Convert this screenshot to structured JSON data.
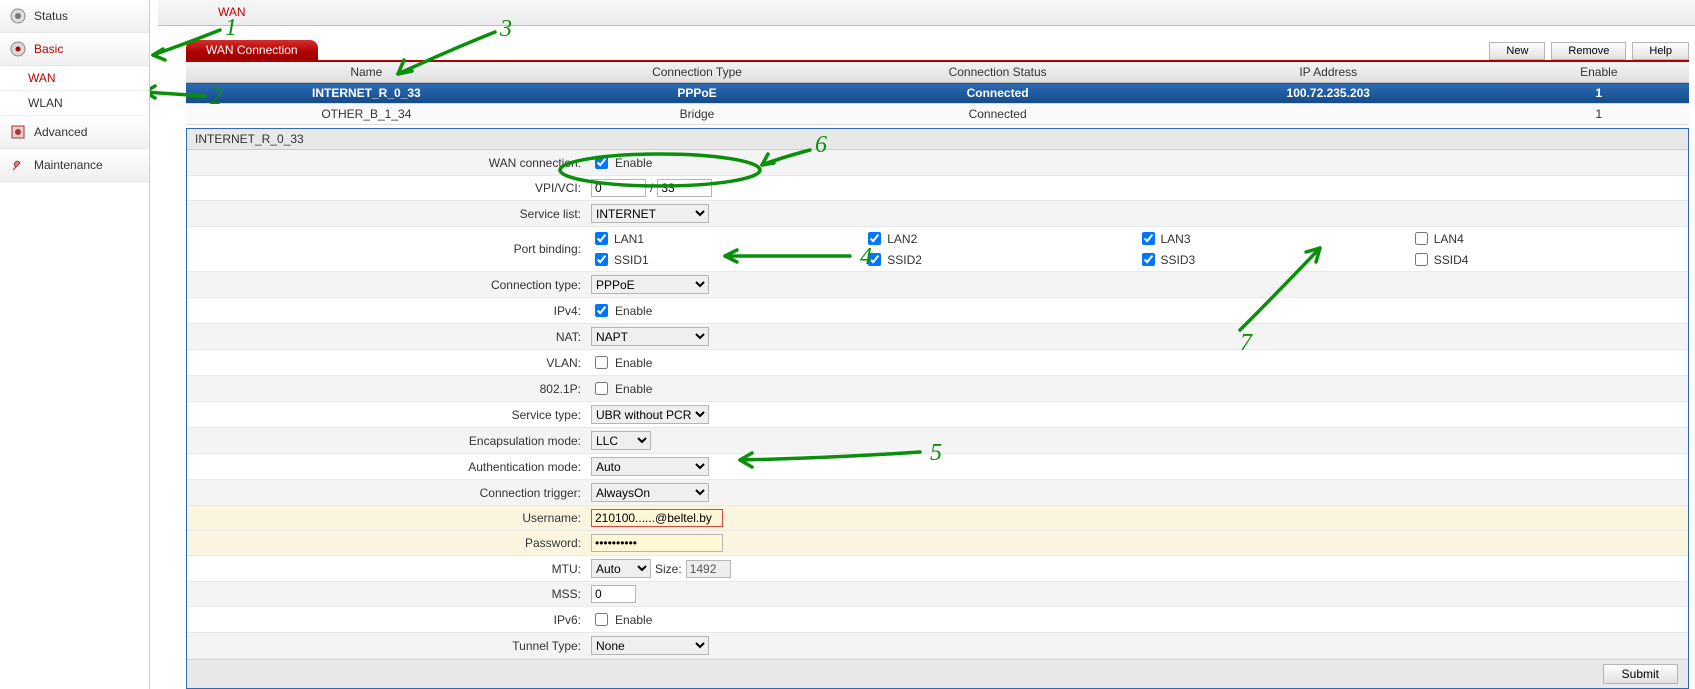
{
  "sidebar": {
    "status": "Status",
    "basic": "Basic",
    "wan": "WAN",
    "wlan": "WLAN",
    "advanced": "Advanced",
    "maintenance": "Maintenance"
  },
  "tabs": {
    "wan": "WAN"
  },
  "header": {
    "title": "WAN Connection",
    "new": "New",
    "remove": "Remove",
    "help": "Help"
  },
  "table": {
    "cols": {
      "name": "Name",
      "type": "Connection Type",
      "status": "Connection Status",
      "ip": "IP Address",
      "enable": "Enable"
    },
    "rows": [
      {
        "name": "INTERNET_R_0_33",
        "type": "PPPoE",
        "status": "Connected",
        "ip": "100.72.235.203",
        "enable": "1"
      },
      {
        "name": "OTHER_B_1_34",
        "type": "Bridge",
        "status": "Connected",
        "ip": "",
        "enable": "1"
      }
    ]
  },
  "form": {
    "title": "INTERNET_R_0_33",
    "wan_connection_label": "WAN connection:",
    "enable_text": "Enable",
    "vpivci_label": "VPI/VCI:",
    "vpi": "0",
    "vci": "33",
    "service_list_label": "Service list:",
    "service_list": "INTERNET",
    "port_binding_label": "Port binding:",
    "pb": {
      "lan1": "LAN1",
      "lan2": "LAN2",
      "lan3": "LAN3",
      "lan4": "LAN4",
      "ssid1": "SSID1",
      "ssid2": "SSID2",
      "ssid3": "SSID3",
      "ssid4": "SSID4"
    },
    "connection_type_label": "Connection type:",
    "connection_type": "PPPoE",
    "ipv4_label": "IPv4:",
    "nat_label": "NAT:",
    "nat": "NAPT",
    "vlan_label": "VLAN:",
    "p8021_label": "802.1P:",
    "service_type_label": "Service type:",
    "service_type": "UBR without PCR",
    "encap_label": "Encapsulation mode:",
    "encap": "LLC",
    "auth_label": "Authentication mode:",
    "auth": "Auto",
    "trigger_label": "Connection trigger:",
    "trigger": "AlwaysOn",
    "username_label": "Username:",
    "username": "210100......@beltel.by",
    "password_label": "Password:",
    "password": "••••••••••",
    "mtu_label": "MTU:",
    "mtu_mode": "Auto",
    "size_label": "Size:",
    "mtu_size": "1492",
    "mss_label": "MSS:",
    "mss": "0",
    "ipv6_label": "IPv6:",
    "tunnel_label": "Tunnel Type:",
    "tunnel": "None",
    "submit": "Submit"
  },
  "annotations": {
    "a1": "1",
    "a2": "2",
    "a3": "3",
    "a4": "4",
    "a5": "5",
    "a6": "6",
    "a7": "7"
  }
}
